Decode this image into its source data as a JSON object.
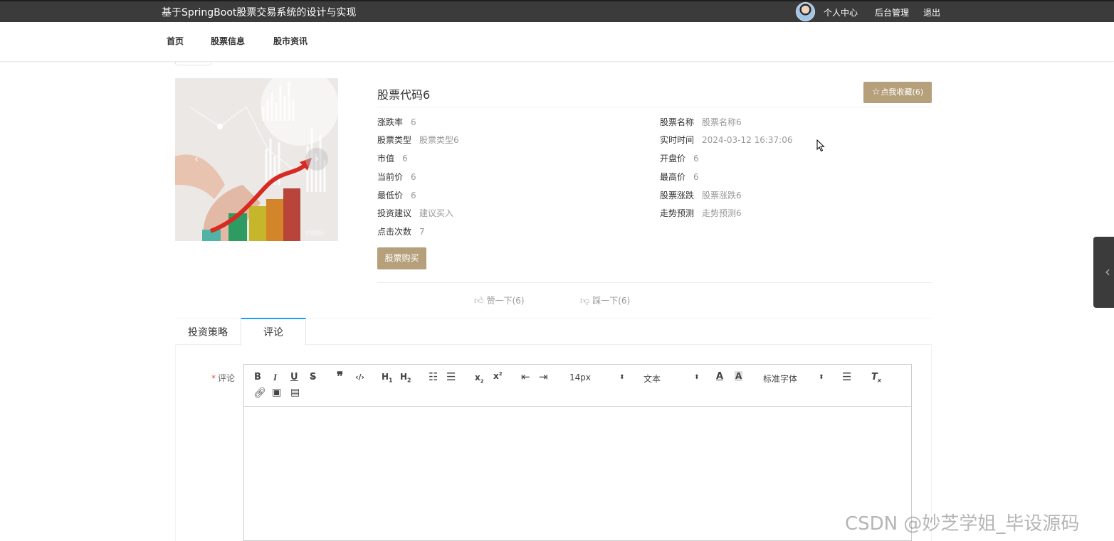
{
  "header": {
    "site_title": "基于SpringBoot股票交易系统的设计与实现",
    "profile_label": "个人中心",
    "admin_label": "后台管理",
    "logout_label": "退出"
  },
  "nav": {
    "items": [
      "首页",
      "股票信息",
      "股市资讯"
    ]
  },
  "stock": {
    "title": "股票代码6",
    "favorite_label": "点我收藏(6)",
    "fields": [
      {
        "label": "涨跌率",
        "value": "6"
      },
      {
        "label": "股票名称",
        "value": "股票名称6"
      },
      {
        "label": "股票类型",
        "value": "股票类型6"
      },
      {
        "label": "实时时间",
        "value": "2024-03-12 16:37:06"
      },
      {
        "label": "市值",
        "value": "6"
      },
      {
        "label": "开盘价",
        "value": "6"
      },
      {
        "label": "当前价",
        "value": "6"
      },
      {
        "label": "最高价",
        "value": "6"
      },
      {
        "label": "最低价",
        "value": "6"
      },
      {
        "label": "股票涨跌",
        "value": "股票涨跌6"
      },
      {
        "label": "投资建议",
        "value": "建议买入"
      },
      {
        "label": "走势预测",
        "value": "走势预测6"
      },
      {
        "label": "点击次数",
        "value": "7"
      }
    ],
    "buy_label": "股票购买",
    "like_label": "赞一下(6)",
    "dislike_label": "踩一下(6)"
  },
  "carousel": {
    "prev_icon": "chevron-left-icon",
    "next_icon": "chevron-right-icon",
    "image_caption": "亿图图示"
  },
  "tabs": [
    {
      "label": "投资策略",
      "active": false
    },
    {
      "label": "评论",
      "active": true
    }
  ],
  "comment_form": {
    "required_mark": "*",
    "label": "评论",
    "font_size": "14px",
    "header_type": "文本",
    "font_family": "标准字体"
  },
  "colors": {
    "topbar_bg": "#3b3b3b",
    "accent_button": "#b5a07b",
    "active_tab_border": "#1e9fff",
    "value_text": "#999999"
  },
  "watermark": "CSDN @妙芝学姐_毕设源码"
}
